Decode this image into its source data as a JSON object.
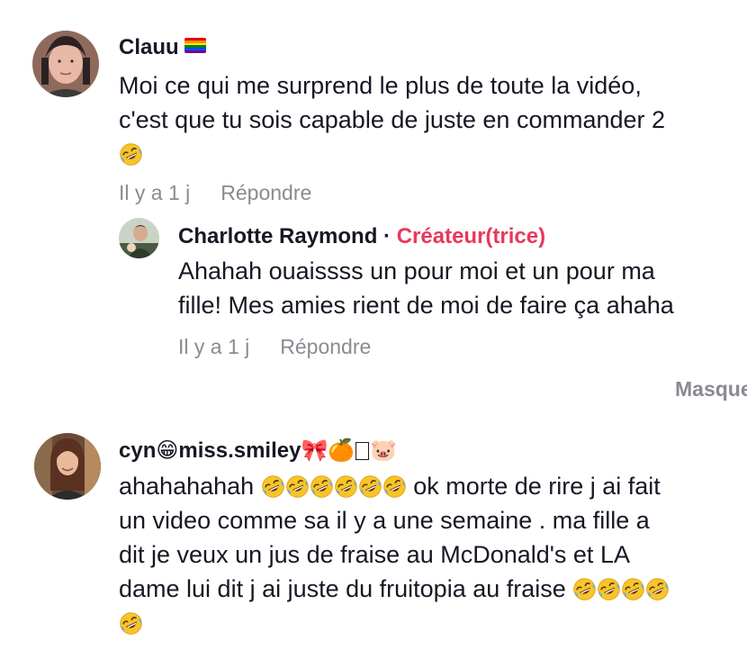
{
  "comments": [
    {
      "username": "Clauu",
      "username_badge_icon": "rainbow-flag-icon",
      "text_lines": [
        "Moi ce qui me surprend le plus de toute la vidéo,",
        "c'est que tu sois capable de juste en commander 2"
      ],
      "time": "Il y a 1 j",
      "reply_label": "Répondre",
      "replies": [
        {
          "username": "Charlotte Raymond",
          "separator": "·",
          "role_badge": "Créateur(trice)",
          "text_lines": [
            "Ahahah ouaissss un pour moi et un pour ma",
            "fille! Mes amies rient de moi de faire ça ahaha"
          ],
          "time": "Il y a 1 j",
          "reply_label": "Répondre"
        }
      ],
      "hide_replies_label": "Masquer"
    },
    {
      "username": "cyn😁miss.smiley🎀🍊",
      "username_suffix": "🐷",
      "text_lines": [
        "ahahahahah",
        "ok morte de rire j ai fait",
        "un video comme sa il y a une semaine . ma fille a",
        "dit je veux un jus de fraise au McDonald's et LA",
        "dame lui dit j ai juste du fruitopia au fraise"
      ]
    }
  ],
  "colors": {
    "text": "#161823",
    "meta": "#8a8b91",
    "creator": "#e9385a"
  }
}
